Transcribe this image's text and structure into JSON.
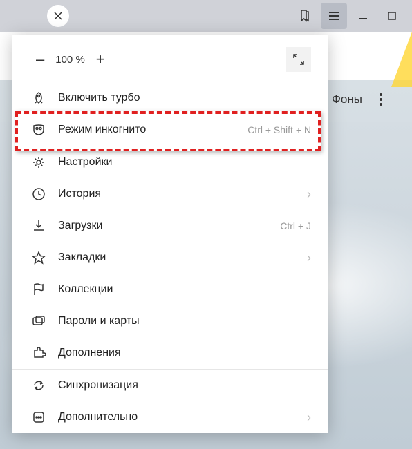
{
  "zoom": {
    "minus": "–",
    "value": "100 %",
    "plus": "+"
  },
  "menu": {
    "turbo": "Включить турбо",
    "incognito": "Режим инкогнито",
    "incognito_shortcut": "Ctrl + Shift + N",
    "settings": "Настройки",
    "history": "История",
    "downloads": "Загрузки",
    "downloads_shortcut": "Ctrl + J",
    "bookmarks": "Закладки",
    "collections": "Коллекции",
    "passwords": "Пароли и карты",
    "addons": "Дополнения",
    "sync": "Синхронизация",
    "more": "Дополнительно"
  },
  "page": {
    "backgrounds_label": "Фоны"
  },
  "chevron": "›"
}
